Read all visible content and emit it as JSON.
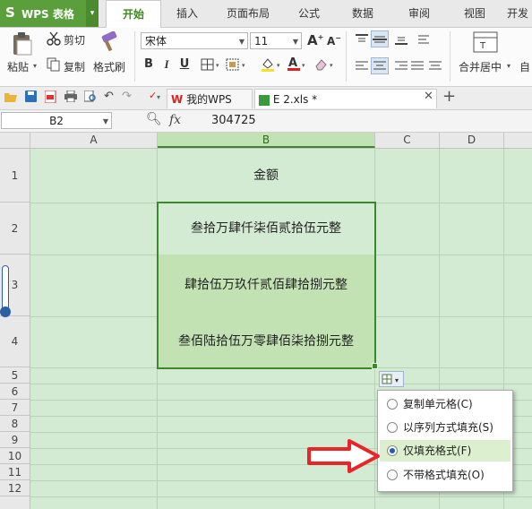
{
  "app": {
    "logo_s": "S",
    "title": "WPS 表格",
    "drop": "▾"
  },
  "menu_tabs": [
    "开始",
    "插入",
    "页面布局",
    "公式",
    "数据",
    "审阅",
    "视图",
    "开发"
  ],
  "ribbon": {
    "paste": "粘贴",
    "cut": "剪切",
    "copy": "复制",
    "format_painter": "格式刷",
    "font_name": "宋体",
    "font_size": "11",
    "bold": "B",
    "italic": "I",
    "underline": "U",
    "merge_center": "合并居中",
    "auto": "自"
  },
  "doc_tabs": [
    {
      "label": "我的WPS"
    },
    {
      "label": "E 2.xls *"
    }
  ],
  "formula_bar": {
    "cell_ref": "B2",
    "fx": "fx",
    "value": "304725"
  },
  "columns": [
    "A",
    "B",
    "C",
    "D"
  ],
  "rows": [
    "1",
    "2",
    "3",
    "4",
    "5",
    "6",
    "7",
    "8",
    "9",
    "10",
    "11",
    "12"
  ],
  "cells": {
    "B1": "金额",
    "B2": "叁拾万肆仟柒佰贰拾伍元整",
    "B3": "肆拾伍万玖仟贰佰肆拾捌元整",
    "B4": "叁佰陆拾伍万零肆佰柒拾捌元整"
  },
  "autofill_menu": {
    "items": [
      {
        "label": "复制单元格(C)",
        "selected": false
      },
      {
        "label": "以序列方式填充(S)",
        "selected": false
      },
      {
        "label": "仅填充格式(F)",
        "selected": true
      },
      {
        "label": "不带格式填充(O)",
        "selected": false
      }
    ]
  },
  "colors": {
    "accent": "#5b9f3c",
    "selection": "#3b8a2a",
    "arrow": "#e8262a",
    "sheet_bg": "#d3ead3"
  }
}
